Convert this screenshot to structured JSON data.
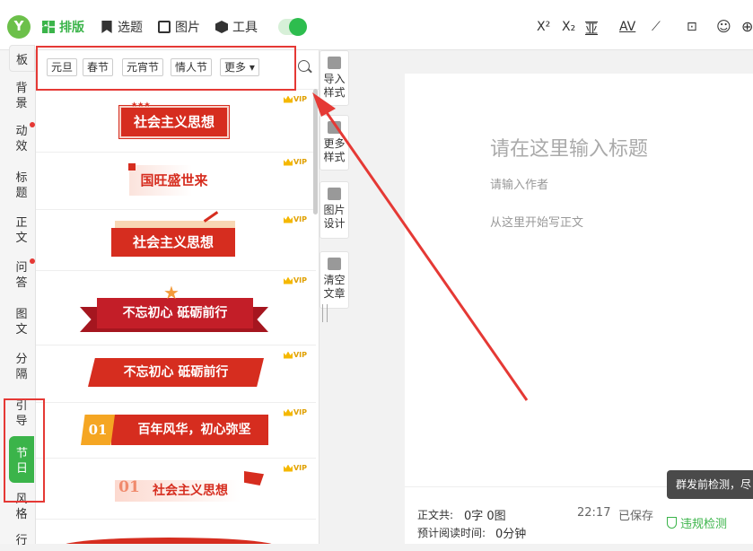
{
  "topbar": {
    "logo": "Y",
    "nav": [
      {
        "label": "排版",
        "icon": "layout-icon"
      },
      {
        "label": "选题",
        "icon": "bookmark-icon"
      },
      {
        "label": "图片",
        "icon": "image-icon"
      },
      {
        "label": "工具",
        "icon": "cube-icon"
      }
    ],
    "format_tools": [
      "X²",
      "X₂",
      "亚",
      "AV",
      "wand-icon",
      "chart-icon",
      "emoji-icon"
    ]
  },
  "leftnav": [
    {
      "label": "板",
      "dot": false
    },
    {
      "label": "背景",
      "dot": false
    },
    {
      "label": "动效",
      "dot": true
    },
    {
      "label": "标题",
      "dot": false
    },
    {
      "label": "正文",
      "dot": false
    },
    {
      "label": "问答",
      "dot": true
    },
    {
      "label": "图文",
      "dot": false
    },
    {
      "label": "分隔",
      "dot": false
    },
    {
      "label": "引导",
      "dot": false
    },
    {
      "label": "节日",
      "dot": false,
      "active": true
    },
    {
      "label": "风格",
      "dot": false
    },
    {
      "label": "行",
      "dot": false
    }
  ],
  "tags": [
    "元旦",
    "春节",
    "元宵节",
    "情人节",
    "更多"
  ],
  "vip_label": "VIP",
  "templates": [
    {
      "text": "社会主义思想"
    },
    {
      "text": "国旺盛世来"
    },
    {
      "text": "社会主义思想"
    },
    {
      "text": "不忘初心 砥砺前行"
    },
    {
      "text": "不忘初心 砥砺前行"
    },
    {
      "num": "01",
      "text": "百年风华，初心弥坚"
    },
    {
      "num": "01",
      "text": "社会主义思想"
    }
  ],
  "sidetools": [
    {
      "label": "导入样式",
      "l1": "导入",
      "l2": "样式"
    },
    {
      "label": "更多样式",
      "l1": "更多",
      "l2": "样式"
    },
    {
      "label": "图片设计",
      "l1": "图片",
      "l2": "设计"
    },
    {
      "label": "清空文章",
      "l1": "清空",
      "l2": "文章"
    }
  ],
  "editor": {
    "title_placeholder": "请在这里输入标题",
    "author_placeholder": "请输入作者",
    "body_placeholder": "从这里开始写正文"
  },
  "footer": {
    "count_label": "正文共:",
    "count_value": "0字 0图",
    "read_label": "预计阅读时间:",
    "read_value": "0分钟",
    "time": "22:17",
    "saved": "已保存",
    "check": "违规检测"
  },
  "tooltip": "群发前检测，尽",
  "colors": {
    "accent": "#3bb44a",
    "banner_red": "#d62d1f",
    "annotation": "#e53935"
  }
}
